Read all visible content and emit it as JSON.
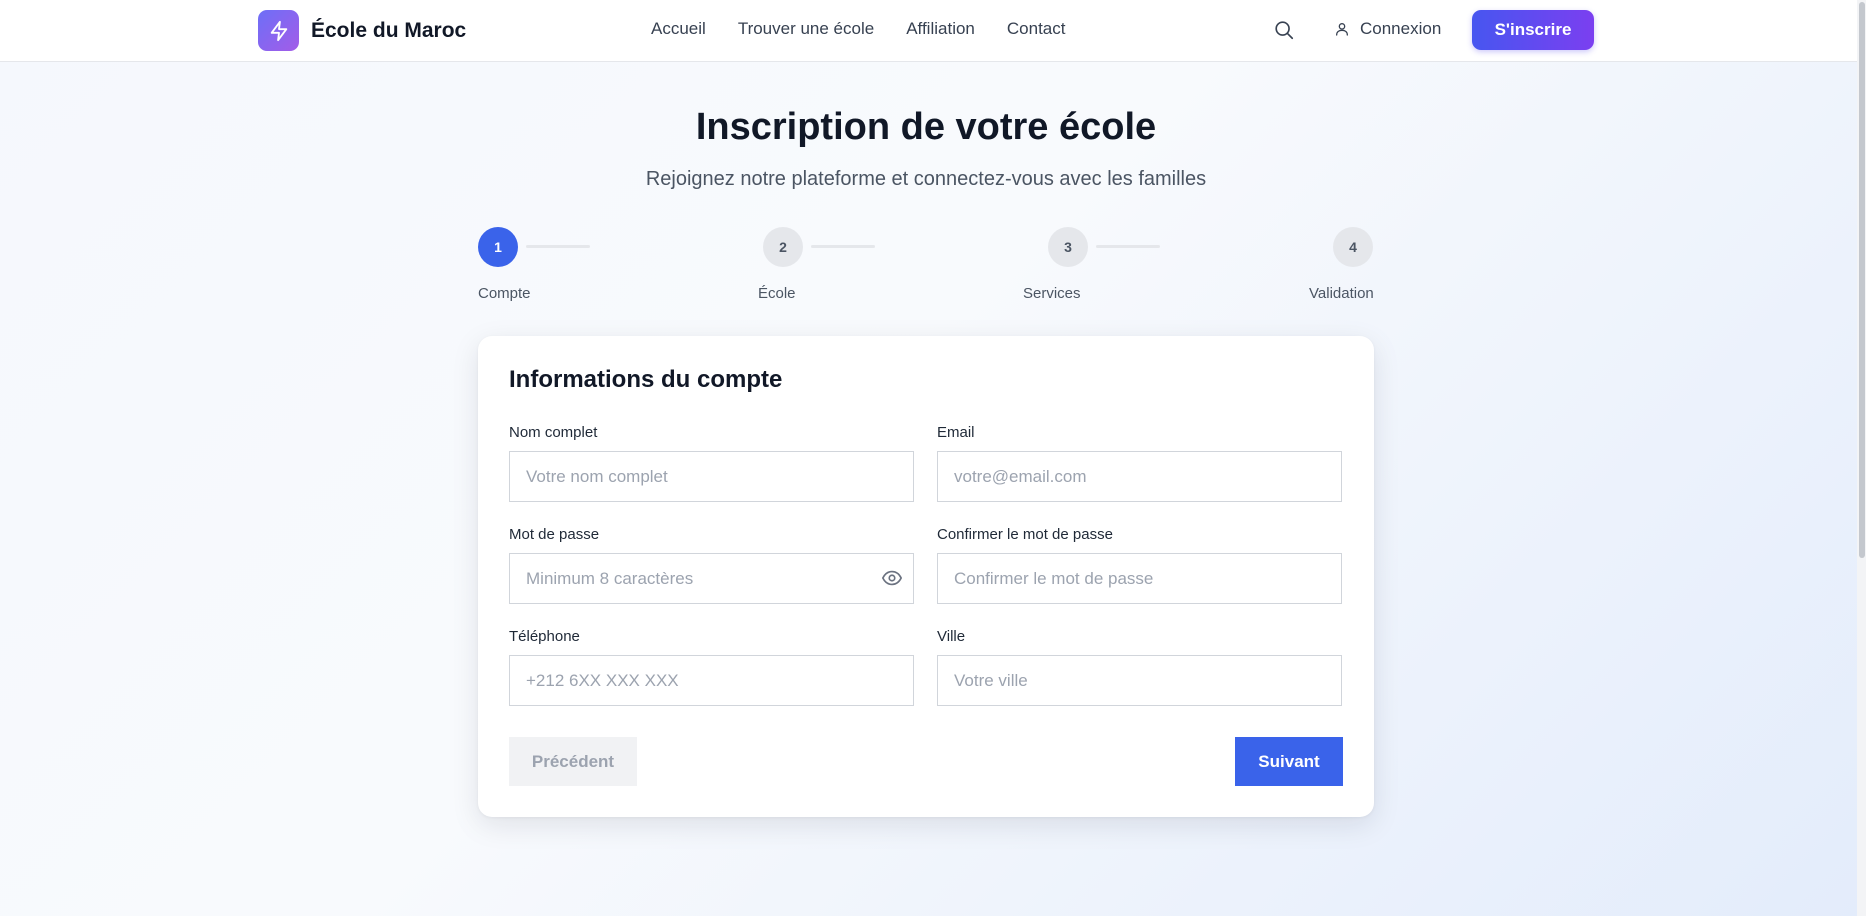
{
  "brand": {
    "name": "École du Maroc",
    "logo_icon": "lightning-bolt-icon",
    "logo_color_start": "#6d6ff7",
    "logo_color_end": "#a35ce8"
  },
  "nav": {
    "links": [
      "Accueil",
      "Trouver une école",
      "Affiliation",
      "Contact"
    ],
    "search_icon": "search-icon",
    "login_label": "Connexion",
    "signup_label": "S'inscrire"
  },
  "page": {
    "title": "Inscription de votre école",
    "subtitle": "Rejoignez notre plateforme et connectez-vous avec les familles"
  },
  "stepper": {
    "current_step": 1,
    "steps": [
      {
        "number": "1",
        "label": "Compte"
      },
      {
        "number": "2",
        "label": "École"
      },
      {
        "number": "3",
        "label": "Services"
      },
      {
        "number": "4",
        "label": "Validation"
      }
    ]
  },
  "form": {
    "title": "Informations du compte",
    "fields": {
      "full_name": {
        "label": "Nom complet",
        "placeholder": "Votre nom complet",
        "value": ""
      },
      "email": {
        "label": "Email",
        "placeholder": "votre@email.com",
        "value": ""
      },
      "password": {
        "label": "Mot de passe",
        "placeholder": "Minimum 8 caractères",
        "value": ""
      },
      "confirm_password": {
        "label": "Confirmer le mot de passe",
        "placeholder": "Confirmer le mot de passe",
        "value": ""
      },
      "phone": {
        "label": "Téléphone",
        "placeholder": "+212 6XX XXX XXX",
        "value": ""
      },
      "city": {
        "label": "Ville",
        "placeholder": "Votre ville",
        "value": ""
      }
    },
    "prev_label": "Précédent",
    "next_label": "Suivant"
  },
  "colors": {
    "accent": "#3a63ea",
    "signup_gradient_start": "#4756f0",
    "signup_gradient_end": "#7b3ff0"
  }
}
